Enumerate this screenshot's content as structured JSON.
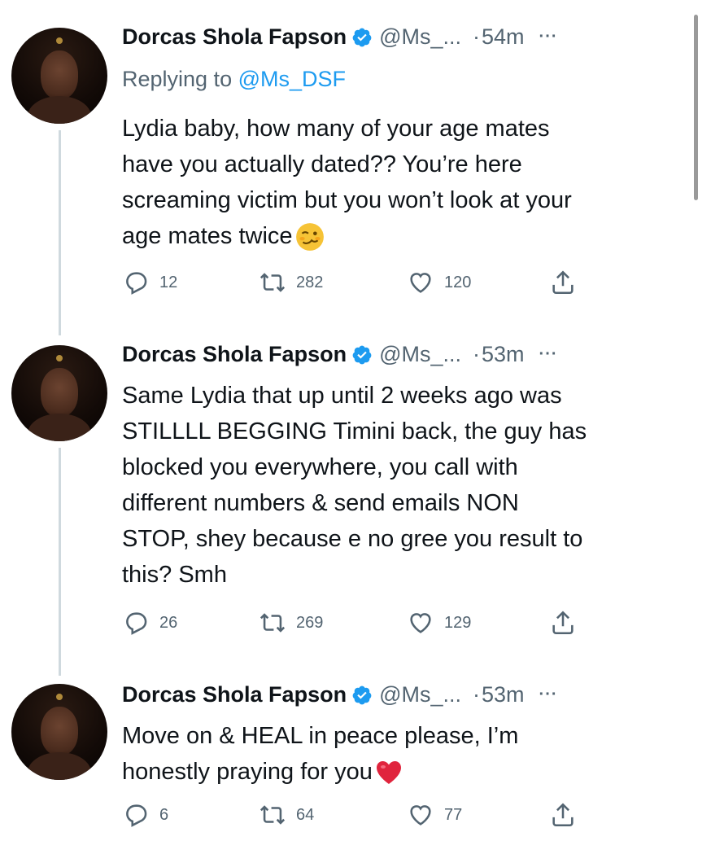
{
  "tweets": [
    {
      "name": "Dorcas Shola Fapson",
      "handle": "@Ms_...",
      "sep": "·",
      "time": "54m",
      "more": "···",
      "replying_prefix": "Replying to ",
      "replying_handle": "@Ms_DSF",
      "lines": [
        "Lydia baby, how many of your age mates",
        "have you actually dated?? You’re here",
        "screaming victim but you won’t look at your",
        "age mates twice"
      ],
      "emoji": "woozy-face-emoji",
      "replies": "12",
      "retweets": "282",
      "likes": "120"
    },
    {
      "name": "Dorcas Shola Fapson",
      "handle": "@Ms_...",
      "sep": "·",
      "time": "53m",
      "more": "···",
      "lines": [
        "Same Lydia that up until 2 weeks ago was",
        "STILLLL BEGGING Timini back, the guy has",
        "blocked you everywhere, you call with",
        "different numbers & send emails NON",
        "STOP, shey because e no gree you result to",
        "this? Smh"
      ],
      "replies": "26",
      "retweets": "269",
      "likes": "129"
    },
    {
      "name": "Dorcas Shola Fapson",
      "handle": "@Ms_...",
      "sep": "·",
      "time": "53m",
      "more": "···",
      "lines": [
        "Move on & HEAL in peace please, I’m",
        "honestly praying for you"
      ],
      "emoji": "red-heart-emoji",
      "replies": "6",
      "retweets": "64",
      "likes": "77"
    }
  ],
  "icons": {
    "reply": "reply-icon",
    "retweet": "retweet-icon",
    "like": "like-icon",
    "share": "share-icon",
    "verified": "verified-badge-icon"
  },
  "colors": {
    "verified": "#1d9bf0",
    "secondary_text": "#536471",
    "link": "#1d9bf0",
    "thread_line": "#cfd9de",
    "heart_emoji": "#e0243d",
    "woozy_emoji": "#f6c336"
  }
}
